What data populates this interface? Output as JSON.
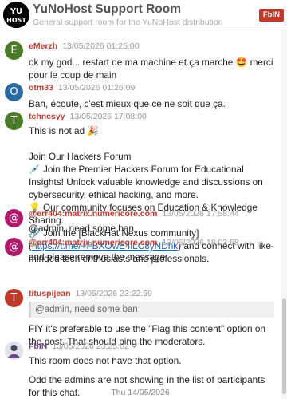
{
  "header": {
    "title": "YuNoHost Support Room",
    "subtitle": "General support room for the YuNoHost distribution",
    "user_badge": "FbIN",
    "logo_text_top": "YU",
    "logo_text_bottom": "HOST"
  },
  "messages": [
    {
      "author": "eMerzh",
      "time": "13/05/2026 01:25:00",
      "avatar_letter": "E",
      "avatar_color": "#4a7a2a",
      "lines": [
        "ok my god... restart de ma machine et ça marche 🤩 merci pour le coup de main"
      ]
    },
    {
      "author": "otm33",
      "time": "13/05/2026 01:26:09",
      "avatar_letter": "O",
      "avatar_color": "#2a6aa0",
      "lines": [
        "Bah, écoute, c'est mieux que ce ne soit que ça."
      ]
    },
    {
      "author": "tchncsyy",
      "time": "13/05/2026 17:08:00",
      "avatar_letter": "T",
      "avatar_color": "#4a7a2a",
      "line1": "This is not ad 🎉",
      "line2": " Join Our Hackers Forum",
      "line3": "💉  Join the Premier Hackers Forum for Educational Insights! Unlock valuable knowledge and discussions on cybersecurity, ethical hacking, and more.",
      "line4": "💡  Our community focuses on Education & Knowledge Sharing.",
      "line5_pre": "🔗  Join the [BlackHat Nexus community](",
      "line5_link": "https://t.me/+FBXOwE4iLC8yNDhk",
      "line5_post": ") and connect with like-minded tech enthusiasts and professionals."
    },
    {
      "author": "@err404:matrix.numericore.com",
      "time": "13/05/2026 17:58:44",
      "avatar_letter": "@",
      "avatar_color": "#b0186a",
      "lines": [
        "@admin, need some ban"
      ]
    },
    {
      "author": "@err404:matrix.numericore.com",
      "time": "13/05/2026 18:03:58",
      "avatar_letter": "@",
      "avatar_color": "#b0186a",
      "lines": [
        "and please remove the message"
      ]
    },
    {
      "author": "tituspijean",
      "time": "13/05/2026 23:22:59",
      "avatar_letter": "T",
      "avatar_color": "#c0392b",
      "quote": "@admin, need some ban",
      "lines": [
        "FIY it's preferable to use the \"Flag this content\" option on the post. That should ping the moderators."
      ]
    },
    {
      "author": "FbIN",
      "time": "13/05/2026 23:25:02",
      "check": "✓",
      "line1": "This room does not have that option.",
      "line2": "Odd the admins are not showing in the list of participants for this chat."
    }
  ],
  "date_separator": "Thu 14/05/2026"
}
